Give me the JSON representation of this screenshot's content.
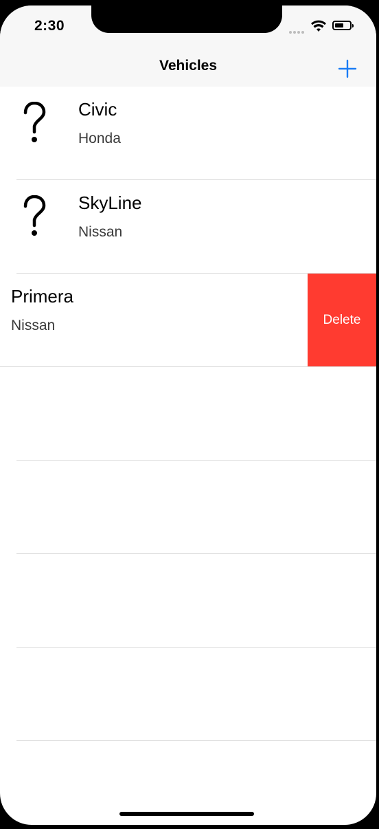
{
  "status_bar": {
    "time": "2:30"
  },
  "nav": {
    "title": "Vehicles",
    "add_icon": "plus-icon"
  },
  "vehicles": [
    {
      "model": "Civic",
      "make": "Honda",
      "icon": "question-mark-icon"
    },
    {
      "model": "SkyLine",
      "make": "Nissan",
      "icon": "question-mark-icon"
    },
    {
      "model": "Primera",
      "make": "Nissan",
      "swiped": true
    }
  ],
  "swipe_action": {
    "label": "Delete",
    "color": "#ff3b30"
  },
  "colors": {
    "accent": "#1a7cf5",
    "delete": "#ff3b30"
  }
}
